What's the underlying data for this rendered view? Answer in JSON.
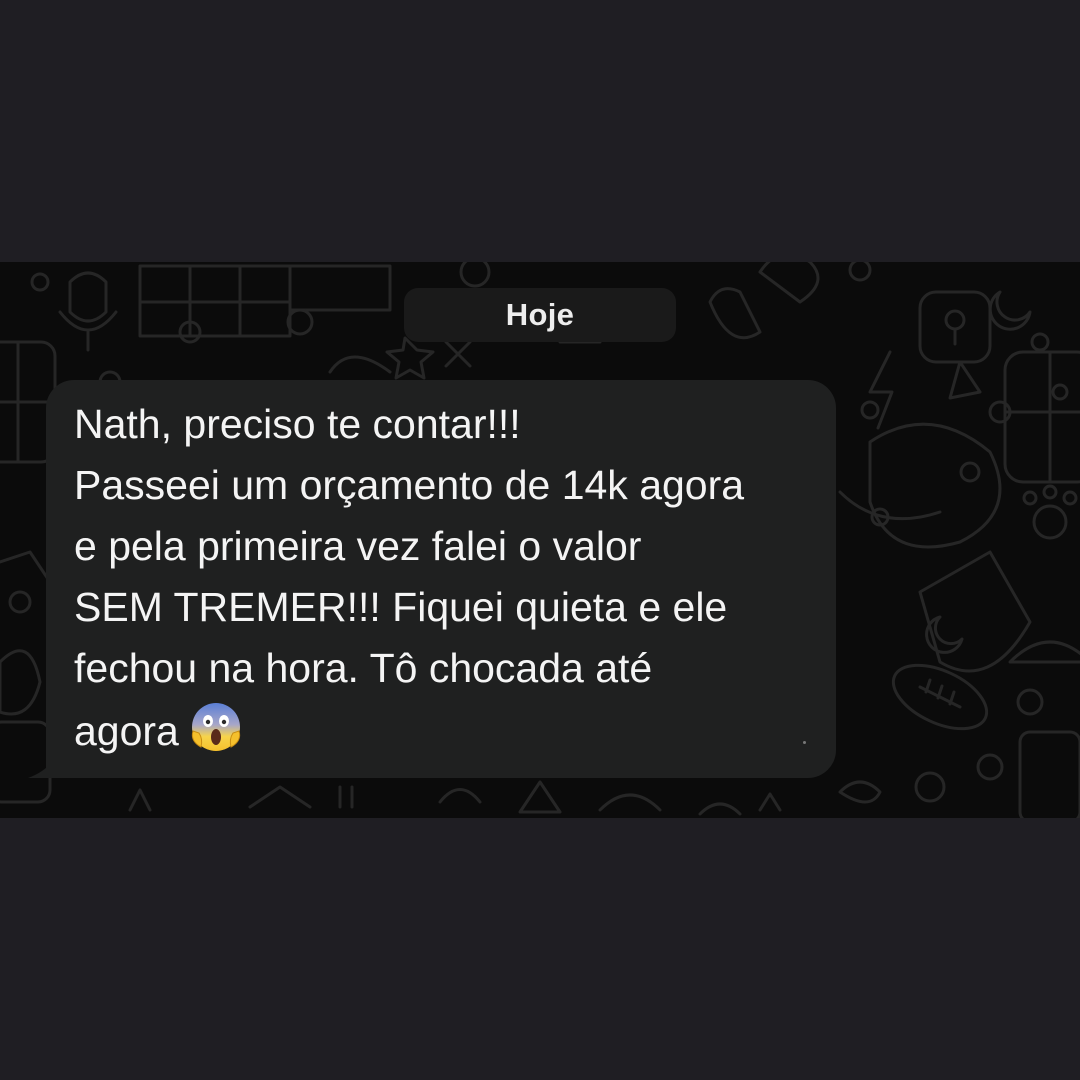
{
  "chat": {
    "date_separator": "Hoje",
    "messages": [
      {
        "direction": "incoming",
        "text": "Nath, preciso te contar!!!\nPasseei um orçamento de 14k agora\ne pela primeira vez falei o valor\nSEM TREMER!!! Fiquei quieta e ele\nfechou na hora. Tô chocada até\nagora",
        "emoji": "face-screaming-in-fear"
      }
    ]
  },
  "colors": {
    "outer_background": "#1f1e23",
    "chat_background": "#0b0b0b",
    "bubble": "#1f2020",
    "text": "#f4f4f4"
  },
  "icons": {
    "wallpaper": "doodle-pattern",
    "reaction": "face-screaming-in-fear"
  }
}
